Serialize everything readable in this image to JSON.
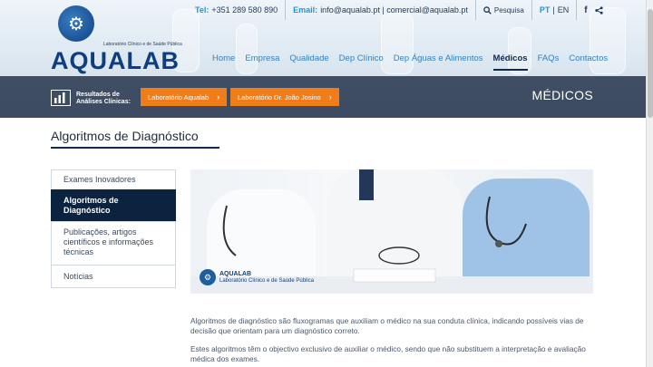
{
  "topbar": {
    "tel_label": "Tel:",
    "tel_value": "+351 289 580 890",
    "email_label": "Email:",
    "email_value": "info@aqualab.pt | comercial@aqualab.pt",
    "search_label": "Pesquisa",
    "lang_pt": "PT",
    "lang_sep": "|",
    "lang_en": "EN"
  },
  "logo": {
    "name": "AQUALAB",
    "tagline": "Laboratório Clínico e de Saúde Pública"
  },
  "nav": {
    "items": [
      {
        "label": "Home"
      },
      {
        "label": "Empresa"
      },
      {
        "label": "Qualidade"
      },
      {
        "label": "Dep Clínico"
      },
      {
        "label": "Dep Águas e Alimentos"
      },
      {
        "label": "Médicos"
      },
      {
        "label": "FAQs"
      },
      {
        "label": "Contactos"
      }
    ],
    "active_index": 5
  },
  "band": {
    "results_label": "Resultados de Análises Clínicas:",
    "btn1": "Laboratório Aqualab",
    "btn2": "Laboratório Dr. João Josino",
    "section_title": "MÉDICOS"
  },
  "page": {
    "title": "Algoritmos de Diagnóstico"
  },
  "sidebar": {
    "items": [
      {
        "label": "Exames Inovadores"
      },
      {
        "label": "Algoritmos de Diagnóstico"
      },
      {
        "label": "Publicações, artigos científicos e informações técnicas"
      },
      {
        "label": "Notícias"
      }
    ],
    "active_index": 1
  },
  "photo_logo": {
    "name": "AQUALAB",
    "tagline": "Laboratório Clínico e de Saúde Pública"
  },
  "content": {
    "para1": "Algoritmos de diagnóstico são fluxogramas que auxiliam o médico na sua conduta clínica, indicando possíveis vias de decisão que orientam para um diagnóstico correto.",
    "para2": "Estes algoritmos têm o objectivo exclusivo de auxiliar o médico, sendo que não substituem a interpretação e avaliação médica dos exames."
  },
  "colors": {
    "brand_blue": "#0d3f80",
    "accent_blue": "#2196d6",
    "orange": "#f07d17",
    "navy": "#0c2340"
  }
}
